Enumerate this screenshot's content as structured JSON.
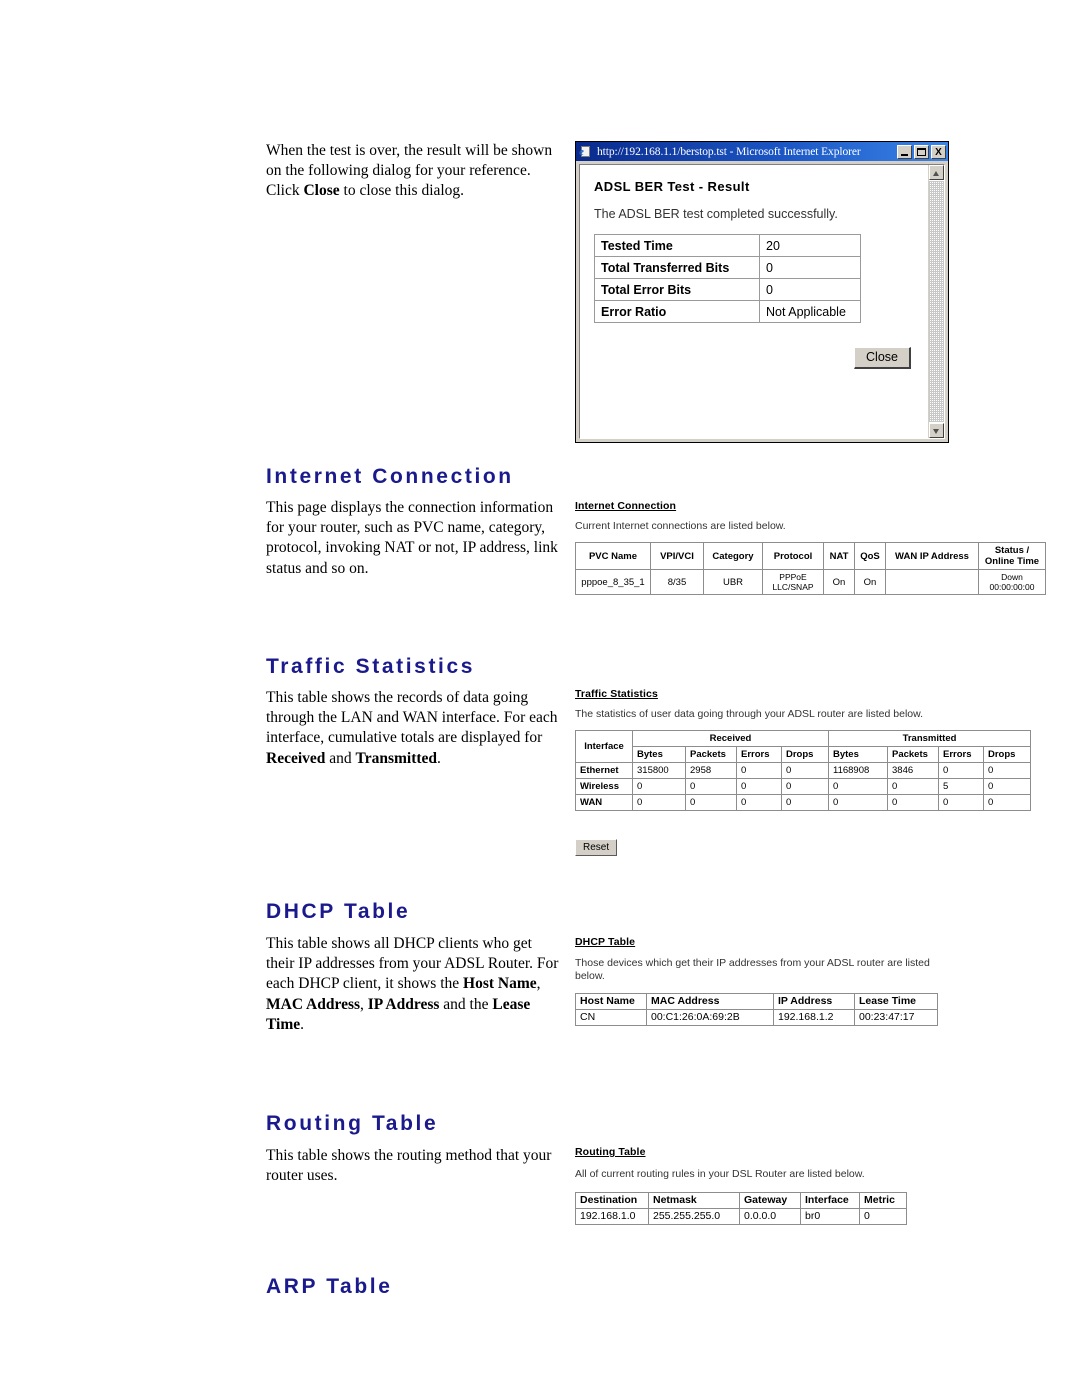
{
  "intro": {
    "paragraph_prefix": "When the test is over, the result will be shown on the following dialog for your reference. Click ",
    "paragraph_bold": "Close",
    "paragraph_suffix": " to close this dialog."
  },
  "ie_window": {
    "title": "http://192.168.1.1/berstop.tst - Microsoft Internet Explorer",
    "favicon": "internet-explorer-icon",
    "minimize_label": "Minimize",
    "maximize_label": "Maximize",
    "close_label": "X",
    "page": {
      "heading": "ADSL BER Test - Result",
      "description": "The ADSL BER test completed successfully.",
      "rows": [
        {
          "label": "Tested Time",
          "value": "20"
        },
        {
          "label": "Total Transferred Bits",
          "value": "0"
        },
        {
          "label": "Total Error Bits",
          "value": "0"
        },
        {
          "label": "Error Ratio",
          "value": "Not Applicable"
        }
      ],
      "close_button": "Close"
    }
  },
  "sections": [
    {
      "heading": "Internet Connection",
      "body_html": "This page displays the connection information for your router, such as PVC name, category, protocol, invoking NAT or not, IP address, link status and so on.",
      "shot": {
        "title": "Internet Connection",
        "description": "Current Internet connections are listed below.",
        "headers": [
          "PVC Name",
          "VPI/VCI",
          "Category",
          "Protocol",
          "NAT",
          "QoS",
          "WAN IP Address",
          "Status / Online Time"
        ],
        "rows": [
          [
            "pppoe_8_35_1",
            "8/35",
            "UBR",
            "PPPoE LLC/SNAP",
            "On",
            "On",
            "",
            "Down 00:00:00:00"
          ]
        ]
      }
    },
    {
      "heading": "Traffic Statistics",
      "shot": {
        "title": "Traffic Statistics",
        "description": "The statistics of user data going through your ADSL router are listed below.",
        "group_headers": [
          "Interface",
          "Received",
          "Transmitted"
        ],
        "sub_headers": [
          "Bytes",
          "Packets",
          "Errors",
          "Drops",
          "Bytes",
          "Packets",
          "Errors",
          "Drops"
        ],
        "rows": [
          [
            "Ethernet",
            "315800",
            "2958",
            "0",
            "0",
            "1168908",
            "3846",
            "0",
            "0"
          ],
          [
            "Wireless",
            "0",
            "0",
            "0",
            "0",
            "0",
            "0",
            "5",
            "0"
          ],
          [
            "WAN",
            "0",
            "0",
            "0",
            "0",
            "0",
            "0",
            "0",
            "0"
          ]
        ],
        "reset_button": "Reset"
      }
    },
    {
      "heading": "DHCP Table",
      "shot": {
        "title": "DHCP Table",
        "description": "Those devices which get their IP addresses from your ADSL router are listed below.",
        "headers": [
          "Host Name",
          "MAC Address",
          "IP Address",
          "Lease Time"
        ],
        "rows": [
          [
            "CN",
            "00:C1:26:0A:69:2B",
            "192.168.1.2",
            "00:23:47:17"
          ]
        ]
      }
    },
    {
      "heading": "Routing Table",
      "body_html": "This table shows the routing method that your router uses.",
      "shot": {
        "title": "Routing Table",
        "description": "All of current routing rules in your DSL Router are listed below.",
        "headers": [
          "Destination",
          "Netmask",
          "Gateway",
          "Interface",
          "Metric"
        ],
        "rows": [
          [
            "192.168.1.0",
            "255.255.255.0",
            "0.0.0.0",
            "br0",
            "0"
          ]
        ]
      }
    },
    {
      "heading": "ARP Table"
    }
  ],
  "traffic_body": {
    "part1": "This table shows the records of data going through the LAN and WAN interface. For each interface, cumulative totals are displayed for ",
    "bold1": "Received",
    "mid": " and ",
    "bold2": "Transmitted",
    "tail": "."
  },
  "dhcp_body": {
    "part1": "This table shows all DHCP clients who get their IP addresses from your ADSL Router. For each DHCP client, it shows the ",
    "bold1": "Host Name",
    "sep1": ", ",
    "bold2": "MAC Address",
    "sep2": ", ",
    "bold3": "IP Address",
    "mid": " and the ",
    "bold4": "Lease Time",
    "tail": "."
  },
  "colors": {
    "heading_blue": "#1a1a8c",
    "titlebar_blue": "#1b56c4",
    "chrome_gray": "#d4d0c8"
  }
}
